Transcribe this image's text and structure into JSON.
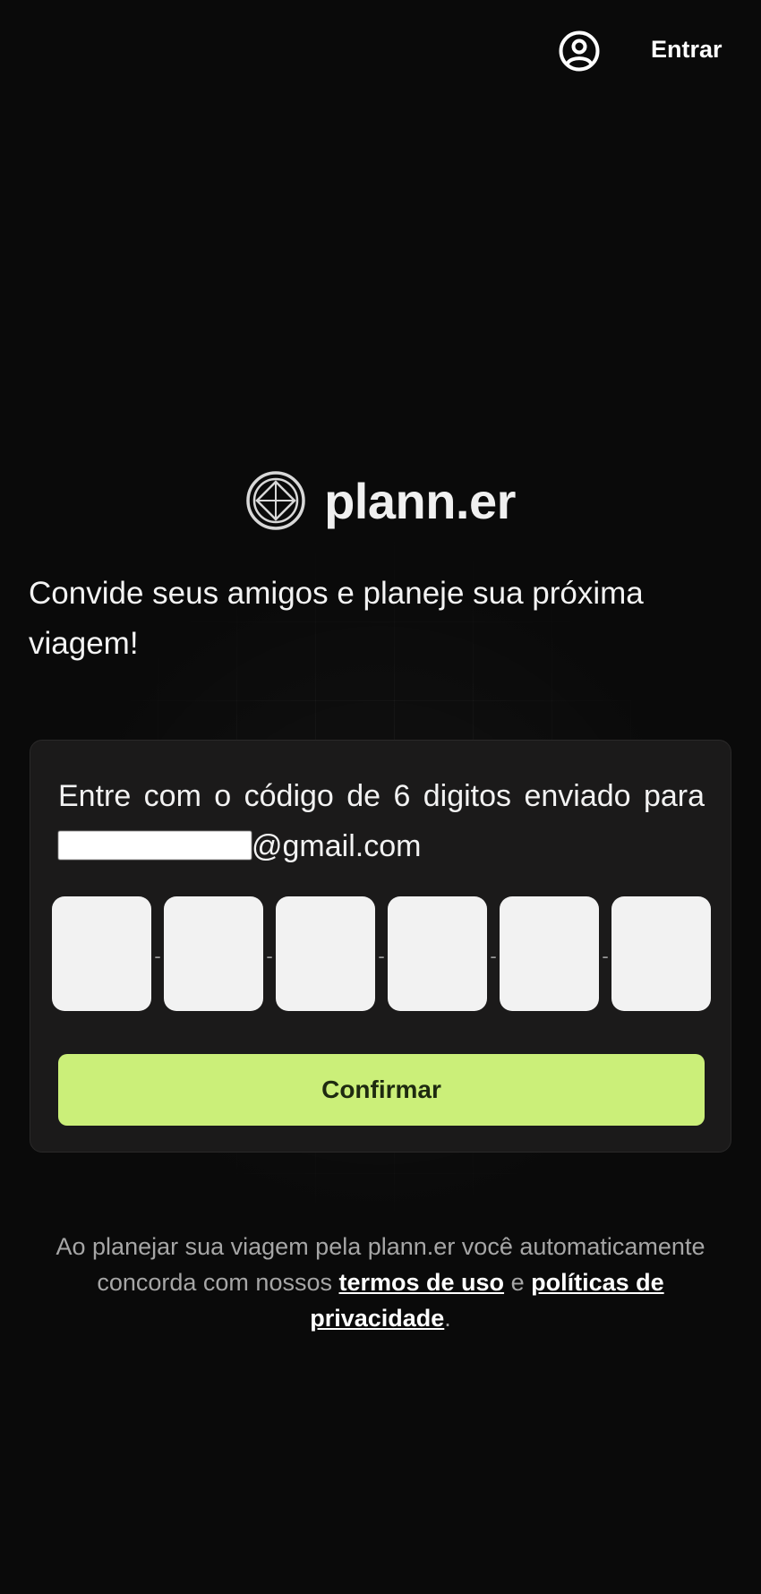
{
  "header": {
    "account_icon": "user-circle-icon",
    "login_label": "Entrar"
  },
  "brand": {
    "logo_icon": "compass-logo-icon",
    "name": "plann.er"
  },
  "tagline": "Convide seus amigos e planeje sua próxima viagem!",
  "verification": {
    "instruction_prefix": "Entre com o código de 6 digitos enviado para",
    "email_domain": "@gmail.com",
    "otp_digits": [
      "",
      "",
      "",
      "",
      "",
      ""
    ],
    "otp_separator": "-",
    "confirm_label": "Confirmar"
  },
  "legal": {
    "text_before": "Ao planejar sua viagem pela plann.er você automaticamente concorda com nossos",
    "terms_link": "termos de uso",
    "conjunction": "e",
    "privacy_link": "políticas de privacidade",
    "text_after": "."
  },
  "colors": {
    "background": "#0a0a0a",
    "card": "#1b1a1a",
    "accent": "#cbef79",
    "otp_box": "#f2f2f2"
  }
}
